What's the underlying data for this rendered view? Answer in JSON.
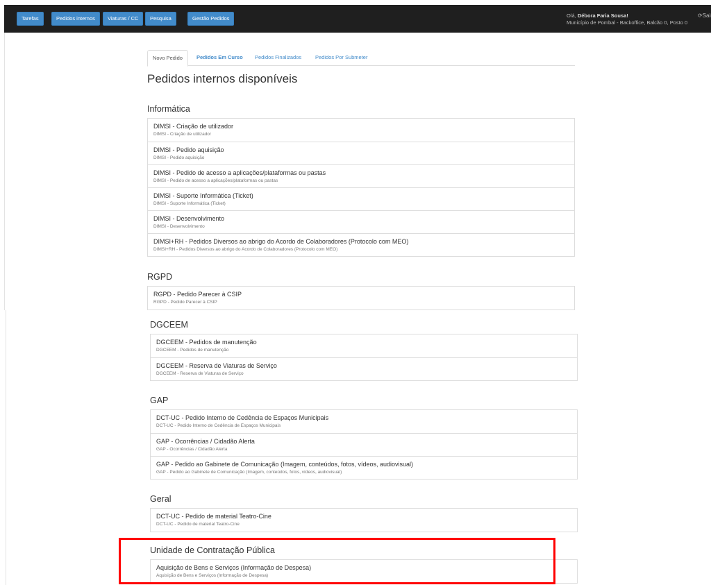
{
  "topbar": {
    "buttons": [
      "Tarefas",
      "Pedidos internos",
      "Viaturas / CC",
      "Pesquisa",
      "Gestão Pedidos"
    ],
    "greeting_prefix": "Olá, ",
    "user_name": "Débora Faria Sousa!",
    "location": "Município de Pombal - Backoffice, Balcão 0, Posto 0",
    "logout_icon": "⟳",
    "logout_label": "Sair"
  },
  "tabs": [
    "Novo Pedido",
    "Pedidos Em Curso",
    "Pedidos Finalizados",
    "Pedidos Por Submeter"
  ],
  "page_title": "Pedidos internos disponíveis",
  "groups": [
    {
      "title": "Informática",
      "items": [
        {
          "title": "DIMSI - Criação de utilizador",
          "subtitle": "DIMSI - Criação de utilizador"
        },
        {
          "title": "DIMSI - Pedido aquisição",
          "subtitle": "DIMSI - Pedido aquisição"
        },
        {
          "title": "DIMSI - Pedido de acesso a aplicações/plataformas ou pastas",
          "subtitle": "DIMSI - Pedido de acesso a aplicações/plataformas ou pastas"
        },
        {
          "title": "DIMSI - Suporte Informática (Ticket)",
          "subtitle": "DIMSI - Suporte Informática (Ticket)"
        },
        {
          "title": "DIMSI - Desenvolvimento",
          "subtitle": "DIMSI - Desenvolvimento"
        },
        {
          "title": "DIMSI+RH - Pedidos Diversos ao abrigo do Acordo de Colaboradores (Protocolo com MEO)",
          "subtitle": "DIMSI+RH - Pedidos Diversos ao abrigo do Acordo de Colaboradores (Protocolo com MEO)"
        }
      ]
    },
    {
      "title": "RGPD",
      "items": [
        {
          "title": "RGPD - Pedido Parecer à CSIP",
          "subtitle": "RGPD - Pedido Parecer à CSIP"
        }
      ]
    },
    {
      "title": "DGCEEM",
      "items": [
        {
          "title": "DGCEEM - Pedidos de manutenção",
          "subtitle": "DGCEEM - Pedidos de manutenção"
        },
        {
          "title": "DGCEEM - Reserva de Viaturas de Serviço",
          "subtitle": "DGCEEM - Reserva de Viaturas de Serviço"
        }
      ]
    },
    {
      "title": "GAP",
      "items": [
        {
          "title": "DCT-UC - Pedido Interno de Cedência de Espaços Municipais",
          "subtitle": "DCT-UC - Pedido Interno de Cedência de Espaços Municipais"
        },
        {
          "title": "GAP - Ocorrências / Cidadão Alerta",
          "subtitle": "GAP - Ocorrências / Cidadão Alerta"
        },
        {
          "title": "GAP - Pedido ao Gabinete de Comunicação (Imagem, conteúdos, fotos, vídeos, audiovisual)",
          "subtitle": "GAP - Pedido ao Gabinete de Comunicação (Imagem, conteúdos, fotos, vídeos, audiovisual)"
        }
      ]
    },
    {
      "title": "Geral",
      "items": [
        {
          "title": "DCT-UC - Pedido de material Teatro-Cine",
          "subtitle": "DCT-UC - Pedido de material Teatro-Cine"
        }
      ]
    },
    {
      "title": "Unidade de Contratação Pública",
      "items": [
        {
          "title": "Aquisição de Bens e Serviços (Informação de Despesa)",
          "subtitle": "Aquisição de Bens e Serviços (Informação de Despesa)"
        }
      ]
    }
  ],
  "colors": {
    "topbar_bg": "#1f1f1f",
    "button_blue": "#428bca",
    "link_blue": "#428bca",
    "highlight_red": "#ff0000"
  }
}
